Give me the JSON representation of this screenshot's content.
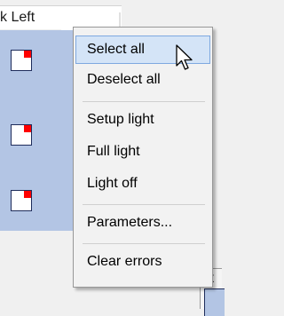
{
  "panel": {
    "title": "k Left"
  },
  "context_menu": {
    "items": [
      {
        "label": "Select all",
        "hovered": true
      },
      {
        "label": "Deselect all"
      },
      {
        "label": "Setup light"
      },
      {
        "label": "Full light"
      },
      {
        "label": "Light off"
      },
      {
        "label": "Parameters..."
      },
      {
        "label": "Clear errors"
      }
    ]
  },
  "bottom_panel": {
    "partial_text": "it"
  },
  "colors": {
    "selection_bg": "#b3c5e4",
    "menu_bg": "#f2f2f2",
    "menu_hover_bg": "#d4e4f7",
    "menu_hover_border": "#7ea8e0",
    "light_indicator": "#ff0000"
  },
  "icons": {
    "cursor": "arrow-cursor-icon",
    "light": "light-status-icon"
  }
}
